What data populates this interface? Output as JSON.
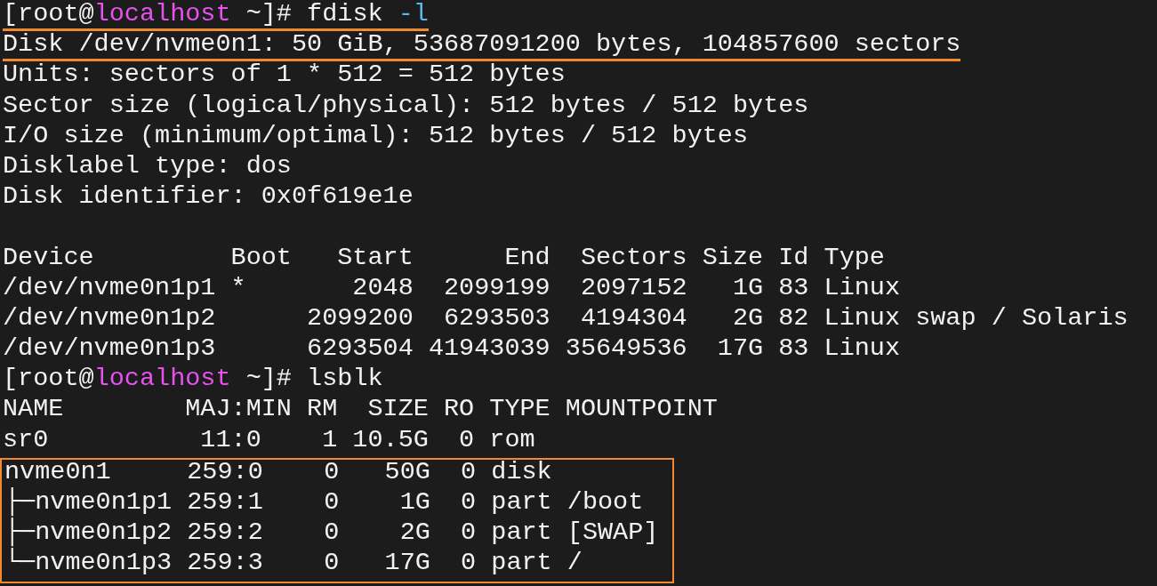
{
  "terminal": {
    "lines": [
      {
        "kind": "prompt",
        "open": "[root@",
        "host": "localhost",
        "close": " ~]# ",
        "command": "fdisk ",
        "flag": "-l",
        "underlined": true
      },
      {
        "kind": "text",
        "text": "Disk /dev/nvme0n1: 50 GiB, 53687091200 bytes, 104857600 sectors",
        "underlined": true
      },
      {
        "kind": "text",
        "text": "Units: sectors of 1 * 512 = 512 bytes",
        "underlined": false
      },
      {
        "kind": "text",
        "text": "Sector size (logical/physical): 512 bytes / 512 bytes",
        "underlined": false
      },
      {
        "kind": "text",
        "text": "I/O size (minimum/optimal): 512 bytes / 512 bytes",
        "underlined": false
      },
      {
        "kind": "text",
        "text": "Disklabel type: dos",
        "underlined": false
      },
      {
        "kind": "text",
        "text": "Disk identifier: 0x0f619e1e",
        "underlined": false
      },
      {
        "kind": "blank"
      },
      {
        "kind": "text",
        "text": "Device         Boot   Start      End  Sectors Size Id Type",
        "underlined": false
      },
      {
        "kind": "text",
        "text": "/dev/nvme0n1p1 *       2048  2099199  2097152   1G 83 Linux",
        "underlined": false
      },
      {
        "kind": "text",
        "text": "/dev/nvme0n1p2      2099200  6293503  4194304   2G 82 Linux swap / Solaris",
        "underlined": false
      },
      {
        "kind": "text",
        "text": "/dev/nvme0n1p3      6293504 41943039 35649536  17G 83 Linux",
        "underlined": false
      },
      {
        "kind": "prompt",
        "open": "[root@",
        "host": "localhost",
        "close": " ~]# ",
        "command": "lsblk",
        "underlined": false
      },
      {
        "kind": "text",
        "text": "NAME        MAJ:MIN RM  SIZE RO TYPE MOUNTPOINT",
        "underlined": false
      },
      {
        "kind": "text",
        "text": "sr0          11:0    1 10.5G  0 rom",
        "underlined": false
      },
      {
        "kind": "box",
        "lines": [
          {
            "kind": "text",
            "text": "nvme0n1     259:0    0   50G  0 disk"
          },
          {
            "kind": "text",
            "text": "├─nvme0n1p1 259:1    0    1G  0 part /boot"
          },
          {
            "kind": "text",
            "text": "├─nvme0n1p2 259:2    0    2G  0 part [SWAP]"
          },
          {
            "kind": "text",
            "text": "└─nvme0n1p3 259:3    0   17G  0 part /"
          }
        ]
      }
    ]
  }
}
